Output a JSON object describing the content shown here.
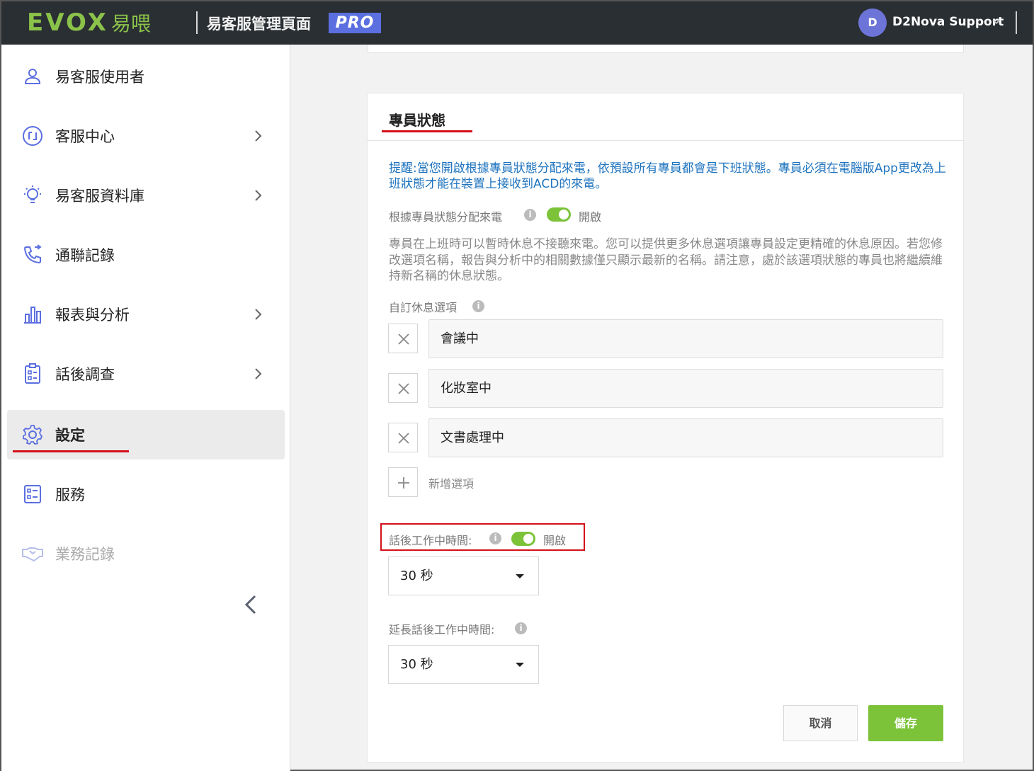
{
  "header": {
    "logo": "EVOX",
    "logo_cn": "易喂",
    "app_title": "易客服管理頁面",
    "pro_badge": "PRO",
    "user_initial": "D",
    "user_name": "D2Nova Support"
  },
  "sidebar": {
    "items": [
      {
        "label": "易客服使用者",
        "icon": "user-icon",
        "has_chevron": false
      },
      {
        "label": "客服中心",
        "icon": "call-center-icon",
        "has_chevron": true
      },
      {
        "label": "易客服資料庫",
        "icon": "lightbulb-icon",
        "has_chevron": true
      },
      {
        "label": "通聯記錄",
        "icon": "phone-log-icon",
        "has_chevron": false
      },
      {
        "label": "報表與分析",
        "icon": "bar-chart-icon",
        "has_chevron": true
      },
      {
        "label": "話後調查",
        "icon": "survey-icon",
        "has_chevron": true
      },
      {
        "label": "設定",
        "icon": "gear-icon",
        "has_chevron": false,
        "active": true
      },
      {
        "label": "服務",
        "icon": "services-icon",
        "has_chevron": false
      },
      {
        "label": "業務記錄",
        "icon": "handshake-icon",
        "has_chevron": false,
        "disabled": true
      }
    ]
  },
  "card": {
    "title": "專員狀態",
    "reminder": "提醒:當您開啟根據專員狀態分配來電，依預設所有專員都會是下班狀態。專員必須在電腦版App更改為上班狀態才能在裝置上接收到ACD的來電。",
    "assign_label": "根據專員狀態分配來電",
    "assign_toggle": "開啟",
    "description": "專員在上班時可以暫時休息不接聽來電。您可以提供更多休息選項讓專員設定更精確的休息原因。若您修改選項名稱，報告與分析中的相關數據僅只顯示最新的名稱。請注意，處於該選項狀態的專員也將繼續維持新名稱的休息狀態。",
    "custom_break_label": "自訂休息選項",
    "break_options": [
      "會議中",
      "化妝室中",
      "文書處理中"
    ],
    "add_option": "新增選項",
    "acw_label": "話後工作中時間:",
    "acw_toggle": "開啟",
    "acw_value": "30 秒",
    "extended_acw_label": "延長話後工作中時間:",
    "extended_acw_value": "30 秒",
    "cancel": "取消",
    "save": "儲存"
  },
  "colors": {
    "topbar": "#2a2f33",
    "accent_green": "#7cc33a",
    "highlight_red": "#d4101a",
    "link_blue": "#1e73be",
    "pro_badge": "#5b6fe0"
  }
}
